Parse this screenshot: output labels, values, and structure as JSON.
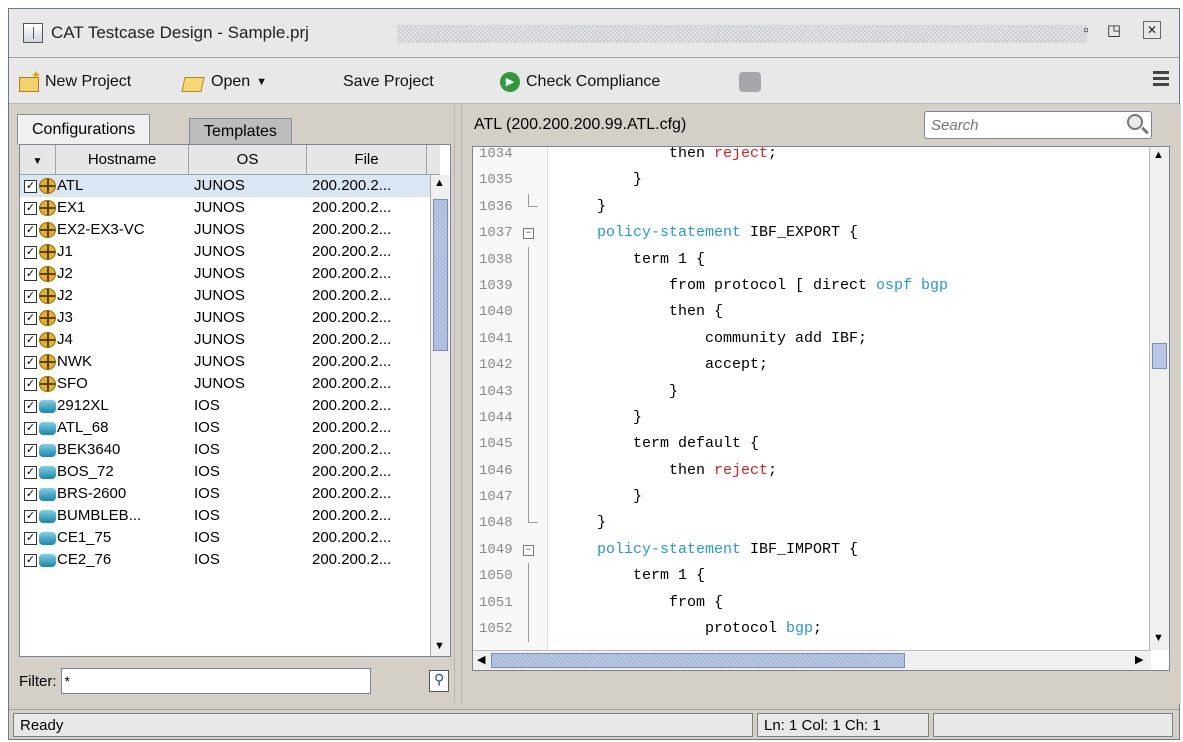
{
  "window": {
    "title": "CAT Testcase Design - Sample.prj"
  },
  "toolbar": {
    "new_project": "New Project",
    "open": "Open",
    "save_project": "Save Project",
    "check_compliance": "Check Compliance"
  },
  "left_panel": {
    "tabs": [
      {
        "label": "Configurations",
        "active": true
      },
      {
        "label": "Templates",
        "active": false
      }
    ],
    "columns": [
      "Hostname",
      "OS",
      "File"
    ],
    "rows": [
      {
        "host": "ATL",
        "os": "JUNOS",
        "file": "200.200.2...",
        "type": "junos",
        "checked": true,
        "selected": true
      },
      {
        "host": "EX1",
        "os": "JUNOS",
        "file": "200.200.2...",
        "type": "junos",
        "checked": true
      },
      {
        "host": "EX2-EX3-VC",
        "os": "JUNOS",
        "file": "200.200.2...",
        "type": "junos",
        "checked": true
      },
      {
        "host": "J1",
        "os": "JUNOS",
        "file": "200.200.2...",
        "type": "junos",
        "checked": true
      },
      {
        "host": "J2",
        "os": "JUNOS",
        "file": "200.200.2...",
        "type": "junos",
        "checked": true
      },
      {
        "host": "J2",
        "os": "JUNOS",
        "file": "200.200.2...",
        "type": "junos",
        "checked": true
      },
      {
        "host": "J3",
        "os": "JUNOS",
        "file": "200.200.2...",
        "type": "junos",
        "checked": true
      },
      {
        "host": "J4",
        "os": "JUNOS",
        "file": "200.200.2...",
        "type": "junos",
        "checked": true
      },
      {
        "host": "NWK",
        "os": "JUNOS",
        "file": "200.200.2...",
        "type": "junos",
        "checked": true
      },
      {
        "host": "SFO",
        "os": "JUNOS",
        "file": "200.200.2...",
        "type": "junos",
        "checked": true
      },
      {
        "host": "2912XL",
        "os": "IOS",
        "file": "200.200.2...",
        "type": "ios",
        "checked": true
      },
      {
        "host": "ATL_68",
        "os": "IOS",
        "file": "200.200.2...",
        "type": "ios",
        "checked": true
      },
      {
        "host": "BEK3640",
        "os": "IOS",
        "file": "200.200.2...",
        "type": "ios",
        "checked": true
      },
      {
        "host": "BOS_72",
        "os": "IOS",
        "file": "200.200.2...",
        "type": "ios",
        "checked": true
      },
      {
        "host": "BRS-2600",
        "os": "IOS",
        "file": "200.200.2...",
        "type": "ios",
        "checked": true
      },
      {
        "host": "BUMBLEB...",
        "os": "IOS",
        "file": "200.200.2...",
        "type": "ios",
        "checked": true
      },
      {
        "host": "CE1_75",
        "os": "IOS",
        "file": "200.200.2...",
        "type": "ios",
        "checked": true
      },
      {
        "host": "CE2_76",
        "os": "IOS",
        "file": "200.200.2...",
        "type": "ios",
        "checked": true
      }
    ],
    "filter_label": "Filter:",
    "filter_value": "*"
  },
  "editor": {
    "title": "ATL (200.200.200.99.ATL.cfg)",
    "search_placeholder": "Search",
    "lines": [
      {
        "n": "1034",
        "indent": 12,
        "parts": [
          {
            "t": "then "
          },
          {
            "t": "reject",
            "c": "red"
          },
          {
            "t": ";"
          }
        ]
      },
      {
        "n": "1035",
        "indent": 8,
        "parts": [
          {
            "t": "}"
          }
        ]
      },
      {
        "n": "1036",
        "indent": 4,
        "parts": [
          {
            "t": "}"
          }
        ],
        "fold": "end"
      },
      {
        "n": "1037",
        "indent": 4,
        "parts": [
          {
            "t": "policy-statement",
            "c": "kw"
          },
          {
            "t": " IBF_EXPORT {"
          }
        ],
        "fold": "start"
      },
      {
        "n": "1038",
        "indent": 8,
        "parts": [
          {
            "t": "term 1 {"
          }
        ],
        "fold": "line"
      },
      {
        "n": "1039",
        "indent": 12,
        "parts": [
          {
            "t": "from protocol [ direct "
          },
          {
            "t": "ospf bgp",
            "c": "kw"
          }
        ],
        "fold": "line"
      },
      {
        "n": "1040",
        "indent": 12,
        "parts": [
          {
            "t": "then {"
          }
        ],
        "fold": "line"
      },
      {
        "n": "1041",
        "indent": 16,
        "parts": [
          {
            "t": "community add IBF;"
          }
        ],
        "fold": "line"
      },
      {
        "n": "1042",
        "indent": 16,
        "parts": [
          {
            "t": "accept;"
          }
        ],
        "fold": "line"
      },
      {
        "n": "1043",
        "indent": 12,
        "parts": [
          {
            "t": "}"
          }
        ],
        "fold": "line"
      },
      {
        "n": "1044",
        "indent": 8,
        "parts": [
          {
            "t": "}"
          }
        ],
        "fold": "line"
      },
      {
        "n": "1045",
        "indent": 8,
        "parts": [
          {
            "t": "term default {"
          }
        ],
        "fold": "line"
      },
      {
        "n": "1046",
        "indent": 12,
        "parts": [
          {
            "t": "then "
          },
          {
            "t": "reject",
            "c": "red"
          },
          {
            "t": ";"
          }
        ],
        "fold": "line"
      },
      {
        "n": "1047",
        "indent": 8,
        "parts": [
          {
            "t": "}"
          }
        ],
        "fold": "line"
      },
      {
        "n": "1048",
        "indent": 4,
        "parts": [
          {
            "t": "}"
          }
        ],
        "fold": "end"
      },
      {
        "n": "1049",
        "indent": 4,
        "parts": [
          {
            "t": "policy-statement",
            "c": "kw"
          },
          {
            "t": " IBF_IMPORT {"
          }
        ],
        "fold": "start"
      },
      {
        "n": "1050",
        "indent": 8,
        "parts": [
          {
            "t": "term 1 {"
          }
        ],
        "fold": "line"
      },
      {
        "n": "1051",
        "indent": 12,
        "parts": [
          {
            "t": "from {"
          }
        ],
        "fold": "line"
      },
      {
        "n": "1052",
        "indent": 16,
        "parts": [
          {
            "t": "protocol "
          },
          {
            "t": "bgp",
            "c": "kw"
          },
          {
            "t": ";"
          }
        ],
        "fold": "line"
      }
    ]
  },
  "status": {
    "text": "Ready",
    "position": "Ln: 1 Col: 1 Ch: 1"
  }
}
